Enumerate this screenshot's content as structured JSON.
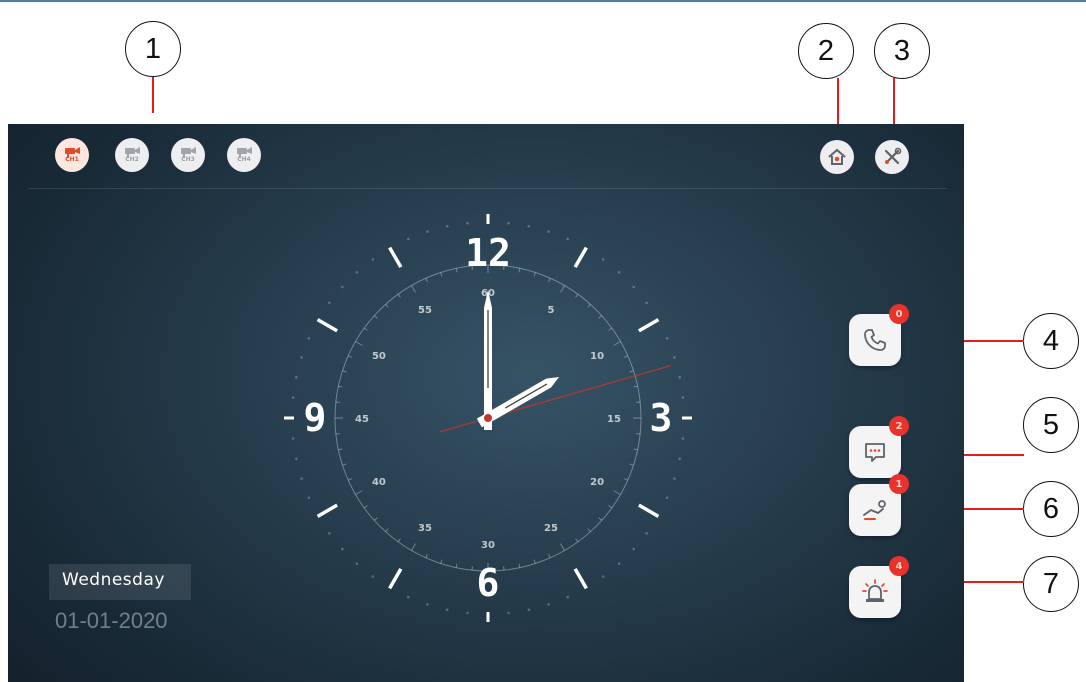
{
  "callouts": [
    "1",
    "2",
    "3",
    "4",
    "5",
    "6",
    "7"
  ],
  "header": {
    "camera_buttons": [
      {
        "label": "CH1",
        "icon": "camera-icon",
        "active": true
      },
      {
        "label": "CH2",
        "icon": "camera-icon",
        "active": false
      },
      {
        "label": "CH3",
        "icon": "camera-icon",
        "active": false
      },
      {
        "label": "CH4",
        "icon": "camera-icon",
        "active": false
      }
    ],
    "home_button_icon": "home-icon",
    "settings_button_icon": "tools-icon"
  },
  "clock": {
    "hour_numerals": [
      "12",
      "3",
      "6",
      "9"
    ],
    "second_labels": [
      "60",
      "5",
      "10",
      "15",
      "20",
      "25",
      "30",
      "35",
      "40",
      "45",
      "50",
      "55"
    ],
    "time_shown": "2:00"
  },
  "side_buttons": [
    {
      "name": "call-log",
      "icon": "phone-icon",
      "badge": "0"
    },
    {
      "name": "messages",
      "icon": "message-icon",
      "badge": "2"
    },
    {
      "name": "intrusion",
      "icon": "intruder-icon",
      "badge": "1"
    },
    {
      "name": "alarm",
      "icon": "alarm-icon",
      "badge": "4"
    }
  ],
  "date": {
    "weekday": "Wednesday",
    "date": "01-01-2020"
  },
  "colors": {
    "badge": "#e8322b",
    "leader": "#e02020",
    "active_camera": "#e24a2c"
  }
}
